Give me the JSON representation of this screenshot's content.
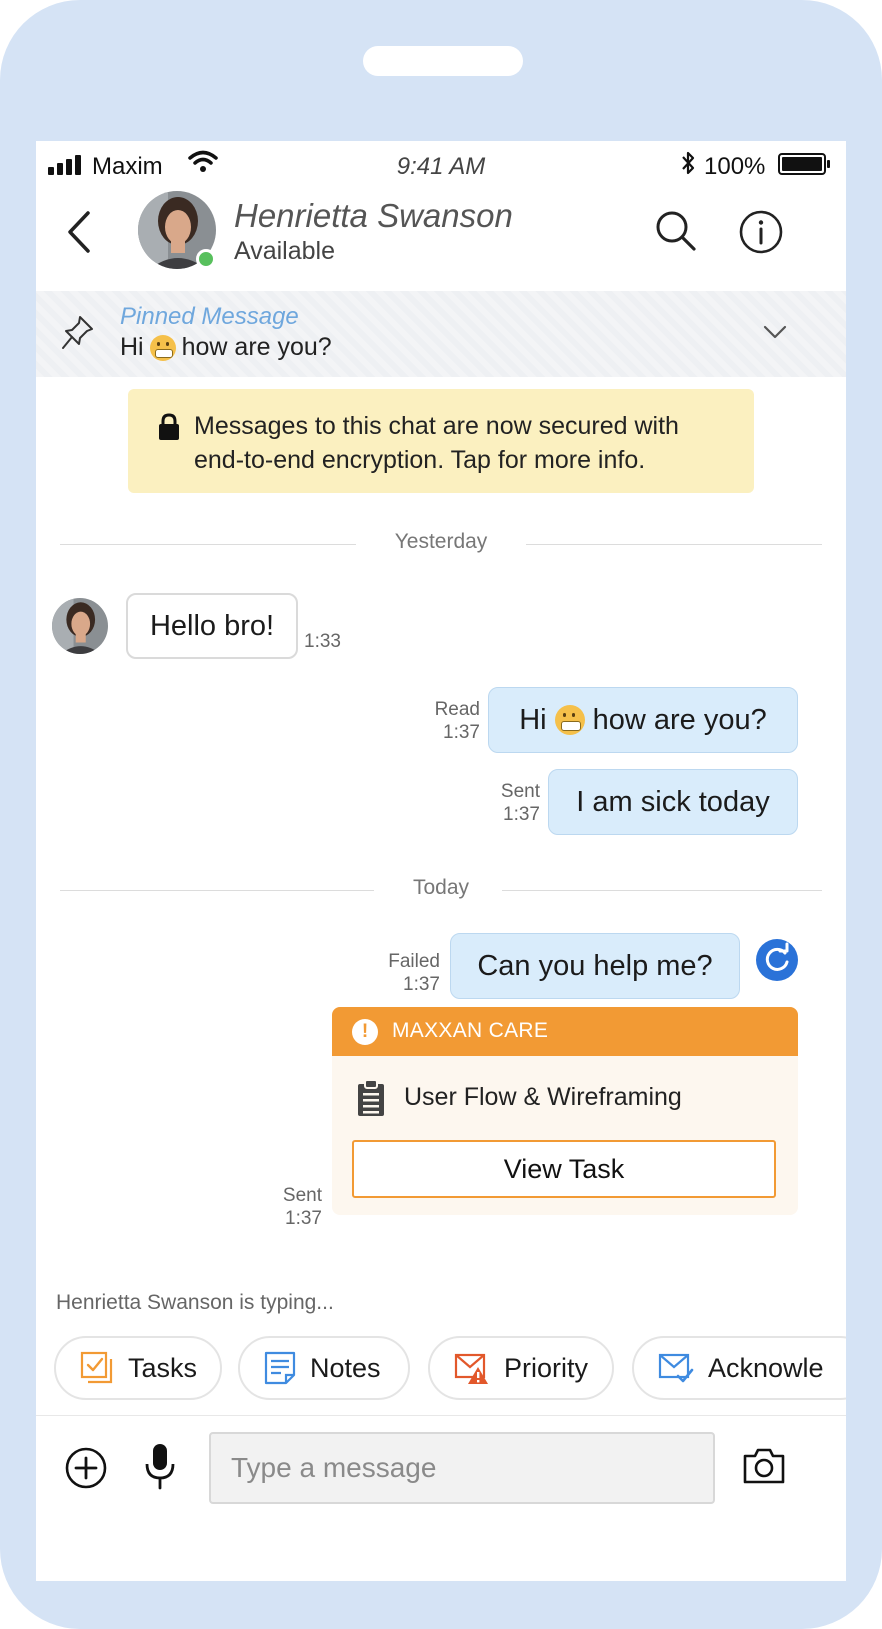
{
  "status_bar": {
    "carrier": "Maxim",
    "time": "9:41 AM",
    "battery": "100%"
  },
  "header": {
    "contact_name": "Henrietta Swanson",
    "contact_status": "Available",
    "presence_color": "#58c05d"
  },
  "pinned": {
    "title": "Pinned Message",
    "text_before": "Hi",
    "text_after": "how are you?"
  },
  "encryption_notice": "Messages to this chat are now secured with end-to-end encryption. Tap for more info.",
  "dividers": {
    "yesterday": "Yesterday",
    "today": "Today"
  },
  "messages": [
    {
      "direction": "in",
      "text": "Hello bro!",
      "time": "1:33"
    },
    {
      "direction": "out",
      "text_before": "Hi",
      "text_after": "how are you?",
      "status": "Read",
      "time": "1:37"
    },
    {
      "direction": "out",
      "text": "I am sick today",
      "status": "Sent",
      "time": "1:37"
    },
    {
      "direction": "out",
      "text": "Can you help me?",
      "status": "Failed",
      "time": "1:37"
    }
  ],
  "task_card": {
    "header": "MAXXAN CARE",
    "task_name": "User Flow & Wireframing",
    "button": "View Task",
    "status": "Sent",
    "time": "1:37",
    "accent": "#f29a34"
  },
  "typing_indicator": "Henrietta Swanson is typing...",
  "quick_actions": [
    {
      "label": "Tasks",
      "icon": "tasks-icon"
    },
    {
      "label": "Notes",
      "icon": "notes-icon"
    },
    {
      "label": "Priority",
      "icon": "priority-icon"
    },
    {
      "label": "Acknowle",
      "icon": "acknowledge-icon"
    }
  ],
  "composer": {
    "placeholder": "Type a message"
  },
  "colors": {
    "frame": "#d5e3f5",
    "outgoing_bubble": "#d9ecfb",
    "pinned_title": "#6fa7dd",
    "encryption_banner": "#fbf0c0",
    "retry": "#2a72d8"
  }
}
